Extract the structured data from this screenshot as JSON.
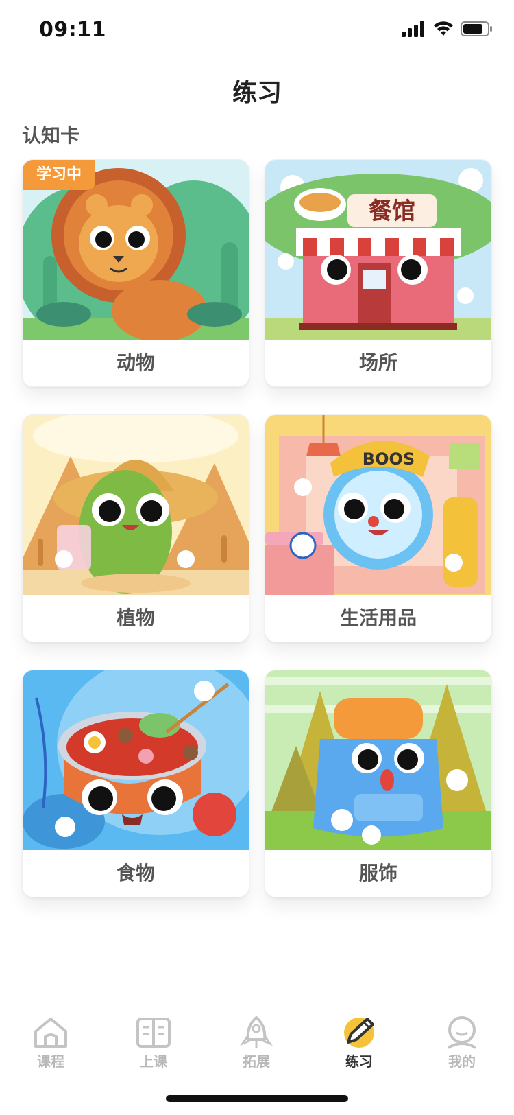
{
  "status_bar": {
    "time": "09:11"
  },
  "page": {
    "title": "练习",
    "section_title": "认知卡"
  },
  "cards": [
    {
      "label": "动物",
      "badge": "学习中"
    },
    {
      "label": "场所",
      "sign": "餐馆"
    },
    {
      "label": "植物"
    },
    {
      "label": "生活用品",
      "hat_text": "BOOS"
    },
    {
      "label": "食物"
    },
    {
      "label": "服饰"
    }
  ],
  "tab_bar": {
    "items": [
      {
        "label": "课程",
        "icon": "home-icon"
      },
      {
        "label": "上课",
        "icon": "book-icon"
      },
      {
        "label": "拓展",
        "icon": "rocket-icon"
      },
      {
        "label": "练习",
        "icon": "pencil-icon",
        "active": true
      },
      {
        "label": "我的",
        "icon": "user-icon"
      }
    ]
  },
  "colors": {
    "badge": "#f59a3a",
    "active_tab": "#333333",
    "inactive_tab": "#b8b8b8"
  }
}
